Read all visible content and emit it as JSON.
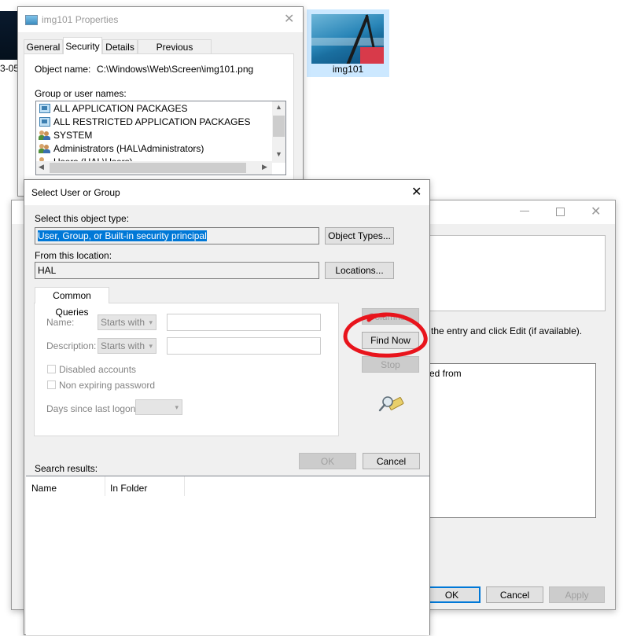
{
  "desktop": {
    "partial_label": "3-05",
    "thumb_label": "img101"
  },
  "properties": {
    "title": "img101 Properties",
    "tabs": [
      "General",
      "Security",
      "Details",
      "Previous Versions"
    ],
    "object_name_label": "Object name:",
    "object_name_value": "C:\\Windows\\Web\\Screen\\img101.png",
    "group_label": "Group or user names:",
    "groups": [
      "ALL APPLICATION PACKAGES",
      "ALL RESTRICTED APPLICATION PACKAGES",
      "SYSTEM",
      "Administrators (HAL\\Administrators)",
      "Users (HAL\\Users)"
    ]
  },
  "advanced": {
    "fragment_edit": "the entry and click Edit (if available).",
    "fragment_inherited": "ed from",
    "ok": "OK",
    "cancel": "Cancel",
    "apply": "Apply"
  },
  "select_dialog": {
    "title": "Select User or Group",
    "object_type_label": "Select this object type:",
    "object_type_value": "User, Group, or Built-in security principal",
    "object_types_button": "Object Types...",
    "location_label": "From this location:",
    "location_value": "HAL",
    "locations_button": "Locations...",
    "tab": "Common Queries",
    "name_label": "Name:",
    "name_mode": "Starts with",
    "description_label": "Description:",
    "description_mode": "Starts with",
    "disabled_accounts": "Disabled accounts",
    "non_expiring": "Non expiring password",
    "days_label": "Days since last logon:",
    "columns_button": "Columns...",
    "find_now_button": "Find Now",
    "stop_button": "Stop",
    "ok": "OK",
    "cancel": "Cancel",
    "search_results_label": "Search results:",
    "columns": [
      "Name",
      "In Folder"
    ]
  },
  "annotation": {
    "color": "#e8141c"
  }
}
